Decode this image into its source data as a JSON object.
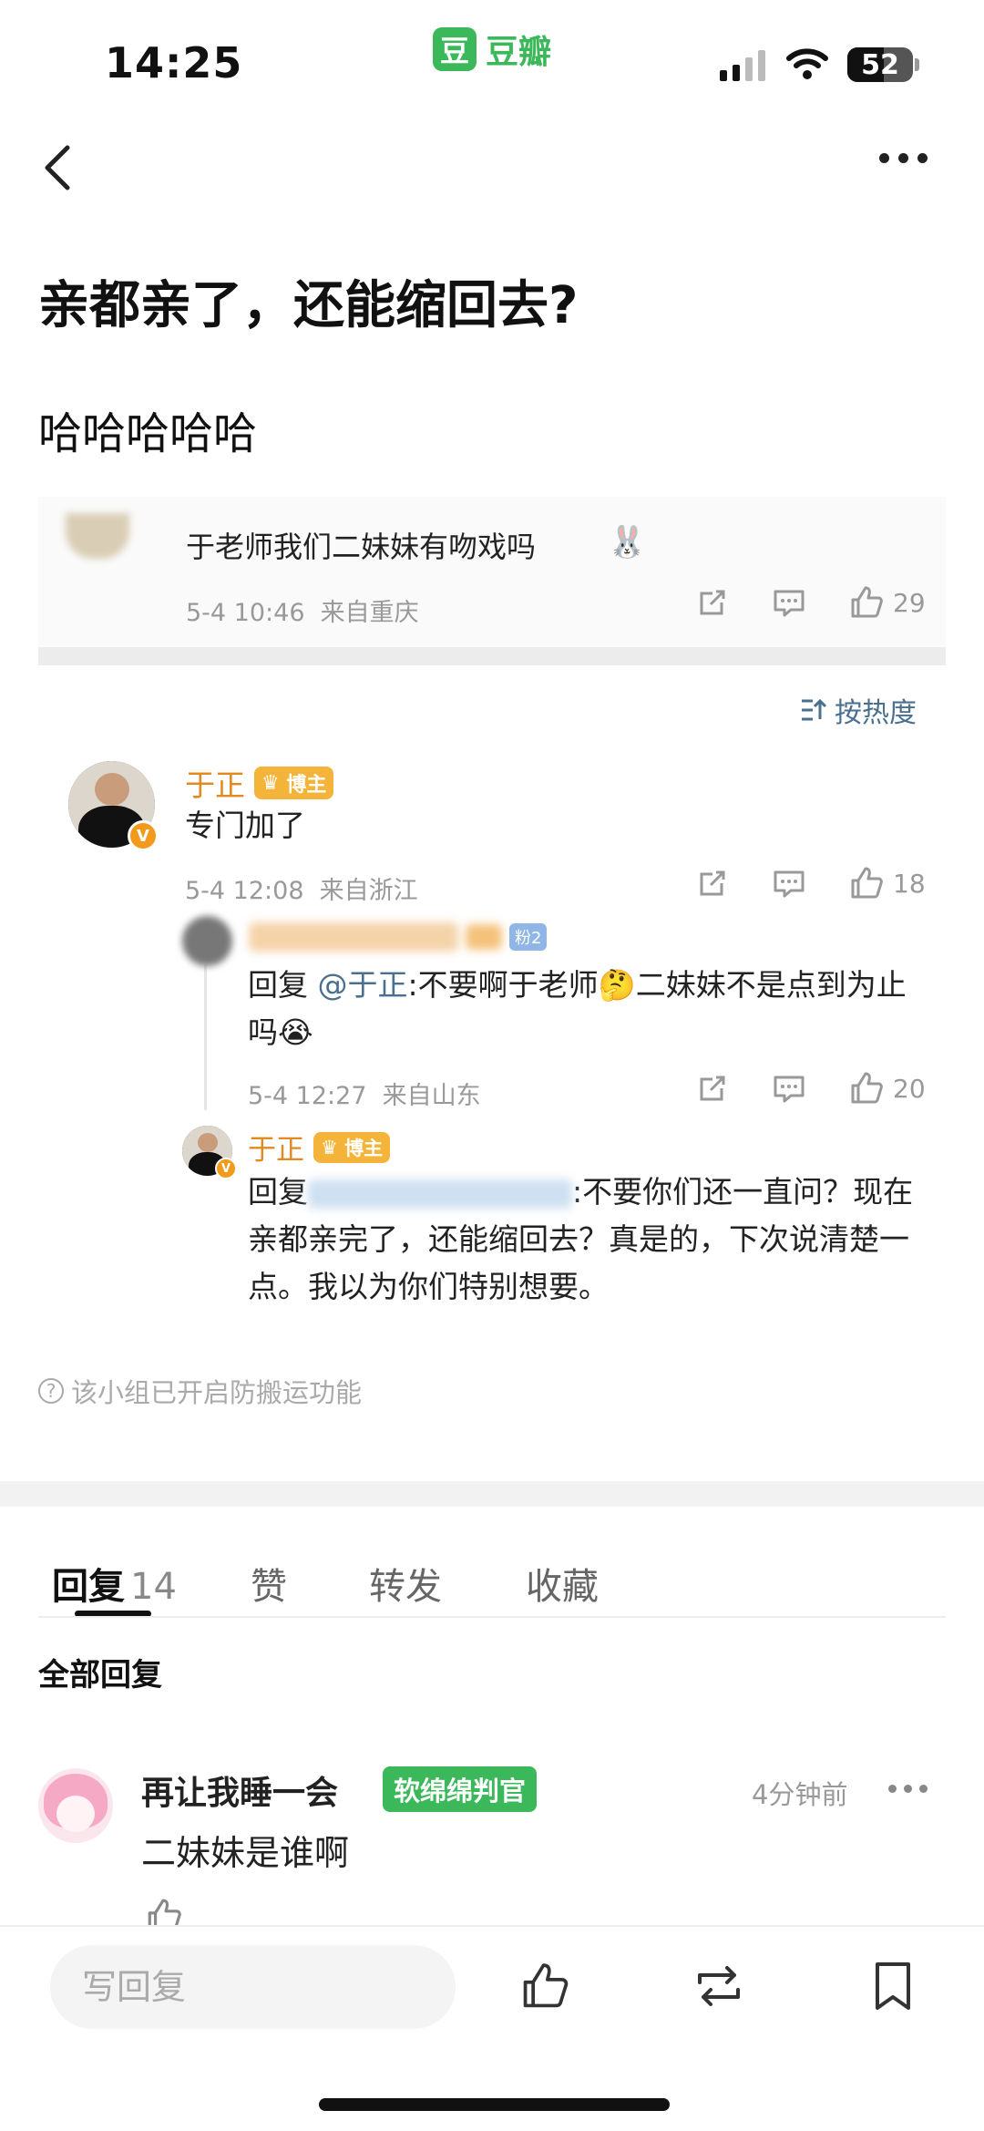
{
  "status": {
    "time": "14:25",
    "app_name": "豆瓣",
    "app_logo": "豆",
    "battery": "52"
  },
  "post": {
    "title": "亲都亲了，还能缩回去?",
    "body": "哈哈哈哈哈"
  },
  "quoted_comment": {
    "text": "于老师我们二妹妹有吻戏吗",
    "date": "5-4 10:46",
    "location": "来自重庆",
    "likes": "29"
  },
  "sort_label": "按热度",
  "comments": [
    {
      "name": "于正",
      "badge": "博主",
      "text": "专门加了",
      "date": "5-4 12:08",
      "location": "来自浙江",
      "likes": "18",
      "replies": [
        {
          "fan_badge": "粉2",
          "reply_prefix": "回复",
          "mention": "@于正",
          "text_part1": ":不要啊于老师",
          "text_part2": "二妹妹不是点到为止吗",
          "date": "5-4 12:27",
          "location": "来自山东",
          "likes": "20"
        },
        {
          "name": "于正",
          "badge": "博主",
          "reply_prefix": "回复",
          "text": ":不要你们还一直问？现在亲都亲完了，还能缩回去？真是的，下次说清楚一点。我以为你们特别想要。"
        }
      ]
    }
  ],
  "anti_copy_notice": "该小组已开启防搬运功能",
  "tabs": [
    {
      "label": "回复",
      "count": "14"
    },
    {
      "label": "赞"
    },
    {
      "label": "转发"
    },
    {
      "label": "收藏"
    }
  ],
  "all_replies_label": "全部回复",
  "replies": [
    {
      "name": "再让我睡一会",
      "tag": "软绵绵判官",
      "time": "4分钟前",
      "text": "二妹妹是谁啊"
    }
  ],
  "bottom_bar": {
    "reply_placeholder": "写回复"
  },
  "colors": {
    "brand_green": "#3bb85a",
    "name_orange": "#e28a1f",
    "link_blue": "#4a6f8f",
    "meta_gray": "#999999"
  },
  "icons": [
    "back-icon",
    "more-icon",
    "share-icon",
    "comment-icon",
    "like-icon",
    "sort-icon",
    "repost-icon",
    "bookmark-icon"
  ]
}
